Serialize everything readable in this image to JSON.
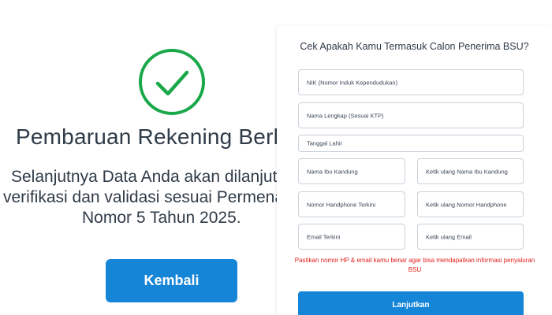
{
  "status": {
    "title": "Pembaruan Rekening Berhasil",
    "message_line1": "Selanjutnya Data Anda akan dilanjutkan ke tahap",
    "message_line2": "verifikasi dan validasi sesuai Permenaker",
    "message_line3": "Nomor 5 Tahun 2025.",
    "back_button": "Kembali",
    "accent_color": "#1aa84a",
    "icon": "checkmark-circle-icon"
  },
  "form": {
    "title": "Cek Apakah Kamu Termasuk Calon Penerima BSU?",
    "fields": {
      "nik": "NIK (Nomor Induk Kependudukan)",
      "nama": "Nama Lengkap (Sesuai KTP)",
      "tanggal_lahir": "Tanggal Lahir",
      "ibu": "Nama Ibu Kandung",
      "ibu_ulang": "Ketik ulang Nama Ibu Kandung",
      "hp": "Nomor Handphone Terkini",
      "hp_ulang": "Ketik ulang Nomor Handphone",
      "email": "Email Terkini",
      "email_ulang": "Ketik ulang Email"
    },
    "warning": "Pastikan nomor HP & email kamu benar agar bisa mendapatkan informasi penyaluran BSU",
    "submit_button": "Lanjutkan",
    "button_color": "#1585d8",
    "warning_color": "#e0201c"
  }
}
